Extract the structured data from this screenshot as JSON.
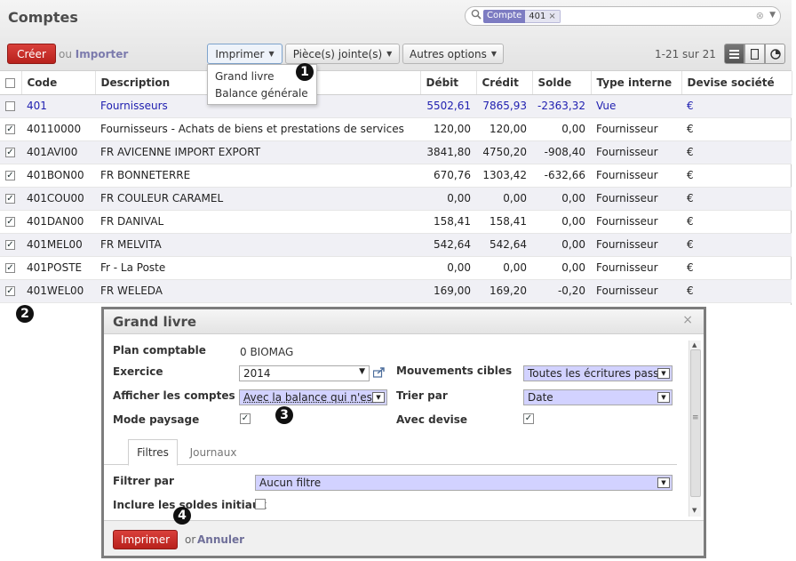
{
  "header": {
    "title": "Comptes",
    "search": {
      "facet_category": "Compte",
      "facet_value": "401",
      "facet_remove": "×",
      "clear": "⊗",
      "dropdown": "▼"
    },
    "create_label": "Créer",
    "or_label": "ou",
    "import_label": "Importer",
    "menus": {
      "print": "Imprimer",
      "attachments": "Pièce(s) jointe(s)",
      "more": "Autres options"
    },
    "pager": "1-21 sur 21",
    "print_menu_items": [
      "Grand livre",
      "Balance générale"
    ]
  },
  "markers": [
    "1",
    "2",
    "3",
    "4"
  ],
  "table": {
    "columns": [
      "Code",
      "Description",
      "Débit",
      "Crédit",
      "Solde",
      "Type interne",
      "Devise société"
    ],
    "rows": [
      {
        "code": "401",
        "description": "Fournisseurs",
        "debit": "5502,61",
        "credit": "7865,93",
        "solde": "-2363,32",
        "type": "Vue",
        "devise": "€",
        "checked": false
      },
      {
        "code": "40110000",
        "description": "Fournisseurs - Achats de biens et prestations de services",
        "debit": "120,00",
        "credit": "120,00",
        "solde": "0,00",
        "type": "Fournisseur",
        "devise": "€",
        "checked": true
      },
      {
        "code": "401AVI00",
        "description": "FR AVICENNE IMPORT EXPORT",
        "debit": "3841,80",
        "credit": "4750,20",
        "solde": "-908,40",
        "type": "Fournisseur",
        "devise": "€",
        "checked": true
      },
      {
        "code": "401BON00",
        "description": "FR BONNETERRE",
        "debit": "670,76",
        "credit": "1303,42",
        "solde": "-632,66",
        "type": "Fournisseur",
        "devise": "€",
        "checked": true
      },
      {
        "code": "401COU00",
        "description": "FR COULEUR CARAMEL",
        "debit": "0,00",
        "credit": "0,00",
        "solde": "0,00",
        "type": "Fournisseur",
        "devise": "€",
        "checked": true
      },
      {
        "code": "401DAN00",
        "description": "FR DANIVAL",
        "debit": "158,41",
        "credit": "158,41",
        "solde": "0,00",
        "type": "Fournisseur",
        "devise": "€",
        "checked": true
      },
      {
        "code": "401MEL00",
        "description": "FR MELVITA",
        "debit": "542,64",
        "credit": "542,64",
        "solde": "0,00",
        "type": "Fournisseur",
        "devise": "€",
        "checked": true
      },
      {
        "code": "401POSTE",
        "description": "Fr - La Poste",
        "debit": "0,00",
        "credit": "0,00",
        "solde": "0,00",
        "type": "Fournisseur",
        "devise": "€",
        "checked": true
      },
      {
        "code": "401WEL00",
        "description": "FR WELEDA",
        "debit": "169,00",
        "credit": "169,20",
        "solde": "-0,20",
        "type": "Fournisseur",
        "devise": "€",
        "checked": true
      }
    ]
  },
  "dialog": {
    "title": "Grand livre",
    "close": "×",
    "fields": {
      "plan_label": "Plan comptable",
      "plan_value": "0 BIOMAG",
      "exercice_label": "Exercice",
      "exercice_value": "2014",
      "afficher_label": "Afficher les comptes",
      "afficher_value": "Avec la balance qui n'est",
      "mode_label": "Mode paysage",
      "mouvements_label": "Mouvements cibles",
      "mouvements_value": "Toutes les écritures pass",
      "trier_label": "Trier par",
      "trier_value": "Date",
      "devise_label": "Avec devise"
    },
    "tabs": [
      "Filtres",
      "Journaux"
    ],
    "filters": {
      "filtrer_label": "Filtrer par",
      "filtrer_value": "Aucun filtre",
      "soldes_label": "Inclure les soldes initiaux"
    },
    "footer": {
      "print": "Imprimer",
      "or": "or",
      "cancel": "Annuler"
    }
  }
}
